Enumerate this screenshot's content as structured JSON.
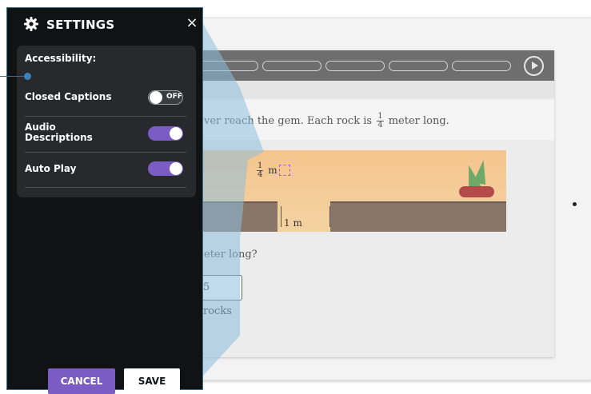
{
  "colors": {
    "panel_bg": "#111214",
    "card_bg": "#27292d",
    "accent_purple": "#7a5cc4",
    "callout_blue": "#3c82b8"
  },
  "settings": {
    "title": "SETTINGS",
    "icon": "gear-icon",
    "close_label": "×",
    "accessibility": {
      "heading": "Accessibility:",
      "options": [
        {
          "label": "Closed Captions",
          "state": "off",
          "toggle_text": "OFF"
        },
        {
          "label": "Audio\nDescriptions",
          "state": "on"
        },
        {
          "label": "Auto Play",
          "state": "on"
        }
      ]
    },
    "buttons": {
      "cancel": "CANCEL",
      "save": "SAVE"
    }
  },
  "lesson": {
    "prompt": "ver reach the gem. Each rock is",
    "fraction": {
      "numerator": "1",
      "denominator": "4"
    },
    "prompt_tail": "meter long.",
    "scene_label_unit": "m",
    "gap_label": "1 m",
    "question_partial": "eter long?",
    "answer_partial": "5 rocks"
  }
}
